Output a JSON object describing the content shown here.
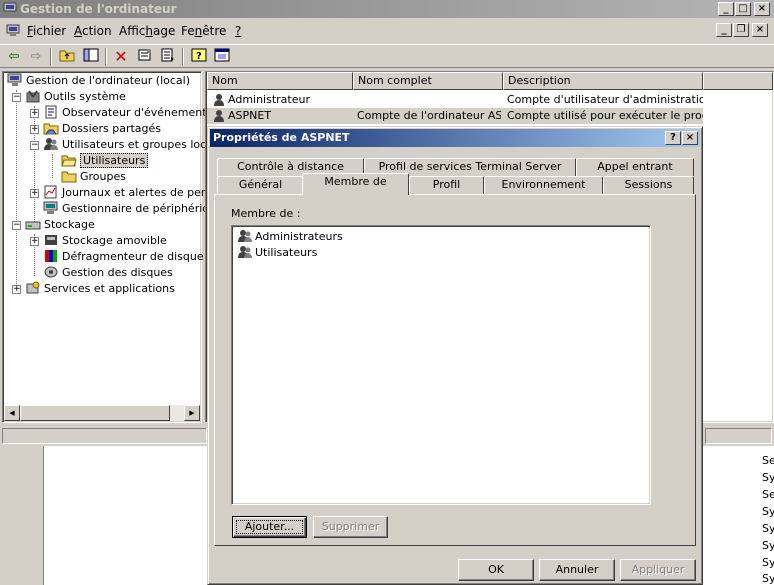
{
  "window": {
    "title": "Gestion de l'ordinateur"
  },
  "menu": {
    "items": [
      {
        "label": "Fichier",
        "accel": "F",
        "rest": "ichier"
      },
      {
        "label": "Action",
        "accel": "A",
        "rest": "ction"
      },
      {
        "label": "Affichage",
        "pre": "Affic",
        "accel": "h",
        "rest": "age"
      },
      {
        "label": "Fenêtre",
        "pre": "Fe",
        "accel": "n",
        "rest": "être"
      },
      {
        "label": "?",
        "accel": "?",
        "rest": ""
      }
    ]
  },
  "toolbar": {
    "icons": [
      "back-arrow-icon",
      "forward-arrow-icon",
      "up-folder-icon",
      "show-tree-icon",
      "delete-icon",
      "properties-icon",
      "export-list-icon",
      "help-icon",
      "console-icon"
    ]
  },
  "tree": {
    "items": [
      {
        "label": "Gestion de l'ordinateur (local)",
        "icon": "computer-management-icon",
        "level": 0
      },
      {
        "label": "Outils système",
        "icon": "system-tools-icon",
        "level": 1,
        "expander": "−"
      },
      {
        "label": "Observateur d'événements",
        "icon": "event-viewer-icon",
        "level": 2,
        "expander": "+"
      },
      {
        "label": "Dossiers partagés",
        "icon": "shared-folders-icon",
        "level": 2,
        "expander": "+"
      },
      {
        "label": "Utilisateurs et groupes locaux",
        "icon": "local-users-icon",
        "level": 2,
        "expander": "−"
      },
      {
        "label": "Utilisateurs",
        "icon": "folder-open-icon",
        "level": 3,
        "selected": true
      },
      {
        "label": "Groupes",
        "icon": "folder-icon",
        "level": 3
      },
      {
        "label": "Journaux et alertes de performance",
        "icon": "performance-logs-icon",
        "level": 2,
        "expander": "+"
      },
      {
        "label": "Gestionnaire de périphériques",
        "icon": "device-manager-icon",
        "level": 2
      },
      {
        "label": "Stockage",
        "icon": "storage-icon",
        "level": 1,
        "expander": "−"
      },
      {
        "label": "Stockage amovible",
        "icon": "removable-storage-icon",
        "level": 2,
        "expander": "+"
      },
      {
        "label": "Défragmenteur de disque",
        "icon": "defragmenter-icon",
        "level": 2
      },
      {
        "label": "Gestion des disques",
        "icon": "disk-management-icon",
        "level": 2
      },
      {
        "label": "Services et applications",
        "icon": "services-apps-icon",
        "level": 1,
        "expander": "+"
      }
    ]
  },
  "list": {
    "columns": [
      "Nom",
      "Nom complet",
      "Description"
    ],
    "rows": [
      {
        "name": "Administrateur",
        "full_name": "",
        "description": "Compte d'utilisateur d'administration"
      },
      {
        "name": "ASPNET",
        "full_name": "Compte de l'ordinateur AS...",
        "description": "Compte utilisé pour exécuter le proc..."
      }
    ]
  },
  "background_stubs": [
    "Se",
    "Sy",
    "Se",
    "Sy",
    "Sy",
    "Sy",
    "Sy",
    "Sy"
  ],
  "dialog": {
    "title": "Propriétés de ASPNET",
    "tabs_back": [
      "Contrôle à distance",
      "Profil de services Terminal Server",
      "Appel entrant"
    ],
    "tabs_front": [
      "Général",
      "Membre de",
      "Profil",
      "Environnement",
      "Sessions"
    ],
    "active_tab": "Membre de",
    "member_label": "Membre de :",
    "members": [
      "Administrateurs",
      "Utilisateurs"
    ],
    "add_label": "Ajouter...",
    "add_accel": "j",
    "remove_label": "Supprimer",
    "ok_label": "OK",
    "cancel_label": "Annuler",
    "apply_label": "Appliquer"
  }
}
